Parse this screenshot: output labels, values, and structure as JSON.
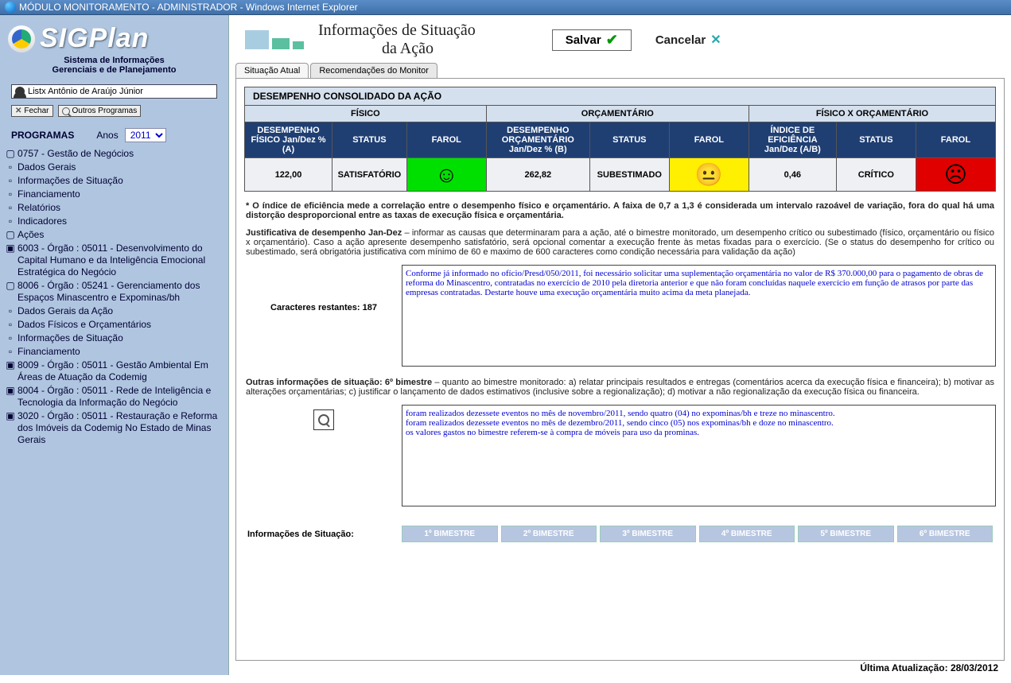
{
  "window": {
    "title": "MÓDULO MONITORAMENTO - ADMINISTRADOR - Windows Internet Explorer"
  },
  "logo": {
    "title": "SIGPlan",
    "subtitle1": "Sistema de Informações",
    "subtitle2": "Gerenciais e de Planejamento"
  },
  "user": "Listx Antônio de Araújo Júnior",
  "buttons": {
    "fechar": "Fechar",
    "outros": "Outros Programas"
  },
  "programas": {
    "label": "PROGRAMAS",
    "anos_lbl": "Anos",
    "anos_val": "2011"
  },
  "tree": {
    "root": "0757 - Gestão de Negócios",
    "c1": "Dados Gerais",
    "c2": "Informações de Situação",
    "c3": "Financiamento",
    "c4": "Relatórios",
    "c5": "Indicadores",
    "c6": "Ações",
    "a1": "6003 - Órgão : 05011 - Desenvolvimento do Capital Humano e da Inteligência Emocional Estratégica do Negócio",
    "a2": "8006 - Órgão : 05241 - Gerenciamento dos Espaços Minascentro e Expominas/bh",
    "a2_1": "Dados Gerais da Ação",
    "a2_2": "Dados Físicos e Orçamentários",
    "a2_3": "Informações de Situação",
    "a2_4": "Financiamento",
    "a3": "8009 - Órgão : 05011 - Gestão Ambiental Em Áreas de Atuação da Codemig",
    "a4": "8004 - Órgão : 05011 - Rede de Inteligência e Tecnologia da Informação do Negócio",
    "a5": "3020 - Órgão : 05011 - Restauração e Reforma dos Imóveis da Codemig No Estado de Minas Gerais"
  },
  "page": {
    "title1": "Informações de Situação",
    "title2": "da Ação",
    "salvar": "Salvar",
    "cancelar": "Cancelar"
  },
  "tabs": {
    "t1": "Situação Atual",
    "t2": "Recomendações do Monitor"
  },
  "table": {
    "title": "DESEMPENHO CONSOLIDADO DA AÇÃO",
    "g1": "FÍSICO",
    "g2": "ORÇAMENTÁRIO",
    "g3": "FÍSICO X ORÇAMENTÁRIO",
    "h_desfis": "DESEMPENHO FÍSICO Jan/Dez % (A)",
    "h_status": "STATUS",
    "h_farol": "FAROL",
    "h_desorc": "DESEMPENHO ORÇAMENTÁRIO Jan/Dez % (B)",
    "h_ind": "ÍNDICE DE EFICIÊNCIA Jan/Dez (A/B)",
    "v_fis": "122,00",
    "s_fis": "SATISFATÓRIO",
    "v_orc": "262,82",
    "s_orc": "SUBESTIMADO",
    "v_ind": "0,46",
    "s_ind": "CRÍTICO"
  },
  "note": "* O índice de eficiência mede a correlação entre o desempenho físico e orçamentário. A faixa de 0,7 a 1,3 é considerada um intervalo razoável de variação, fora do qual há uma distorção desproporcional entre as taxas de execução física e orçamentária.",
  "just_head": "Justificativa de desempenho Jan-Dez",
  "just_body": " – informar as causas que determinaram para a ação, até o bimestre monitorado, um desempenho crítico ou subestimado (físico, orçamentário ou físico x orçamentário). Caso a ação apresente desempenho satisfatório, será opcional comentar a execução frente às metas fixadas para o exercício. (Se o status do desempenho for crítico ou subestimado, será obrigatória justificativa com mínimo de 60 e maximo de 600 caracteres como condição necessária para validação da ação)",
  "charcount_lbl": "Caracteres restantes: 187",
  "ta1": "Conforme já informado no ofício/Presd/050/2011, foi necessário solicitar uma suplementação orçamentária no valor de R$ 370.000,00 para o pagamento de obras de reforma do Minascentro, contratadas no exercício de 2010 pela diretoria anterior e que não foram concluídas naquele exercício em função de atrasos por parte das empresas contratadas. Destarte houve uma execução orçamentária muito acima da meta planejada.",
  "out_head": "Outras informações de situação: 6º bimestre",
  "out_body": " – quanto ao bimestre monitorado: a) relatar principais resultados e entregas (comentários acerca da execução física e financeira); b) motivar as alterações orçamentárias; c) justificar o lançamento de dados estimativos (inclusive sobre a regionalização); d) motivar a não regionalização da execução física ou financeira.",
  "ta2": "foram realizados dezessete eventos no mês de novembro/2011, sendo quatro (04) no expominas/bh e treze no minascentro.\nforam realizados dezessete eventos no mês de dezembro/2011, sendo cinco (05) nos expominas/bh e doze no minascentro.\nos valores gastos no bimestre referem-se à compra de móveis para uso da prominas.",
  "bim": {
    "lbl": "Informações de Situação:",
    "b1": "1º BIMESTRE",
    "b2": "2º BIMESTRE",
    "b3": "3º BIMESTRE",
    "b4": "4º BIMESTRE",
    "b5": "5º BIMESTRE",
    "b6": "6º BIMESTRE"
  },
  "footer": "Última Atualização: 28/03/2012"
}
